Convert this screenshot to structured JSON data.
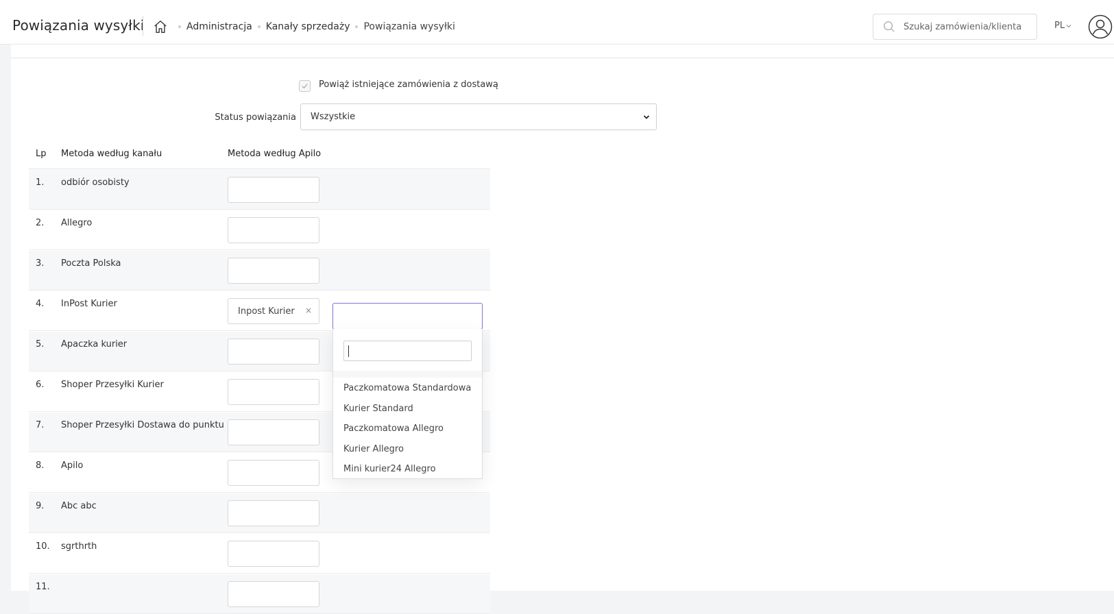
{
  "header": {
    "title": "Powiązania wysyłki",
    "breadcrumbs": [
      "Administracja",
      "Kanały sprzedaży",
      "Powiązania wysyłki"
    ],
    "search_placeholder": "Szukaj zamówienia/klienta",
    "language": "PL"
  },
  "form": {
    "link_existing_label": "Powiąż istniejące zamówienia z dostawą",
    "status_label": "Status powiązania",
    "status_value": "Wszystkie"
  },
  "table": {
    "headers": [
      "Lp",
      "Metoda według kanału",
      "Metoda według Apilo"
    ],
    "rows": [
      {
        "num": "1.",
        "name": "odbiór osobisty",
        "tag": ""
      },
      {
        "num": "2.",
        "name": "Allegro",
        "tag": ""
      },
      {
        "num": "3.",
        "name": "Poczta Polska",
        "tag": ""
      },
      {
        "num": "4.",
        "name": "InPost Kurier",
        "tag": "Inpost Kurier"
      },
      {
        "num": "5.",
        "name": "Apaczka kurier",
        "tag": ""
      },
      {
        "num": "6.",
        "name": "Shoper Przesyłki Kurier",
        "tag": ""
      },
      {
        "num": "7.",
        "name": "Shoper Przesyłki Dostawa do punktu",
        "tag": ""
      },
      {
        "num": "8.",
        "name": "Apilo",
        "tag": ""
      },
      {
        "num": "9.",
        "name": "Abc abc",
        "tag": ""
      },
      {
        "num": "10.",
        "name": "sgrthrth",
        "tag": ""
      },
      {
        "num": "11.",
        "name": "",
        "tag": ""
      }
    ],
    "remove_symbol": "×"
  },
  "dropdown": {
    "options": [
      "Paczkomatowa Standardowa",
      "Kurier Standard",
      "Paczkomatowa Allegro",
      "Kurier Allegro",
      "Mini kurier24 Allegro"
    ]
  }
}
